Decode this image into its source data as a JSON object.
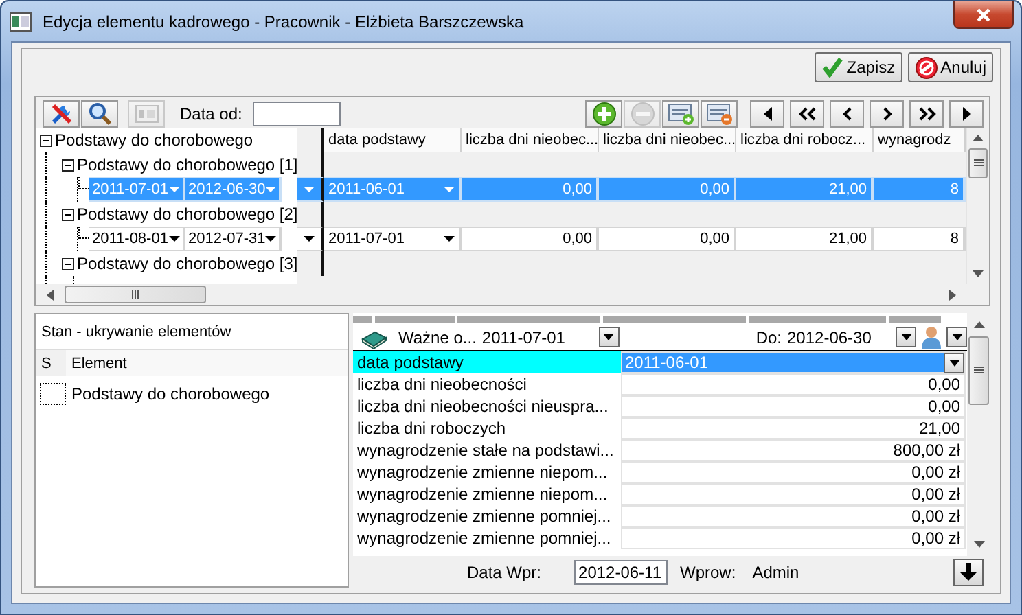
{
  "window": {
    "title": "Edycja elementu kadrowego - Pracownik - Elżbieta Barszczewska"
  },
  "actions": [
    {
      "kind": "save",
      "label": "Zapisz"
    },
    {
      "kind": "cancel",
      "label": "Anuluj"
    }
  ],
  "toolbar": {
    "left_buttons": [
      {
        "kind": "tools",
        "disabled": false
      },
      {
        "kind": "search",
        "disabled": false
      },
      {
        "kind": "counter",
        "disabled": true
      }
    ],
    "date_from_label": "Data od:",
    "right_buttons": [
      {
        "kind": "add",
        "disabled": false
      },
      {
        "kind": "remove",
        "disabled": true
      },
      {
        "kind": "add_record",
        "disabled": false
      },
      {
        "kind": "remove_record",
        "disabled": false
      }
    ],
    "nav_buttons": [
      {
        "kind": "first"
      },
      {
        "kind": "fast_back"
      },
      {
        "kind": "back"
      },
      {
        "kind": "forward"
      },
      {
        "kind": "fast_forward"
      },
      {
        "kind": "last"
      }
    ]
  },
  "grid": {
    "columns": [
      "data podstawy",
      "liczba dni nieobec...",
      "liczba dni nieobec...",
      "liczba dni robocz...",
      "wynagrodz"
    ],
    "tree": {
      "label": "Podstawy do chorobowego",
      "expanded": true,
      "children": [
        {
          "label": "Podstawy do chorobowego [1]",
          "expanded": true,
          "children": [
            {
              "from": "2011-07-01",
              "to": "2012-06-30",
              "selected": true,
              "cells": [
                "2011-06-01",
                "0,00",
                "0,00",
                "21,00",
                "8"
              ]
            }
          ]
        },
        {
          "label": "Podstawy do chorobowego [2]",
          "expanded": true,
          "children": [
            {
              "from": "2011-08-01",
              "to": "2012-07-31",
              "selected": false,
              "cells": [
                "2011-07-01",
                "0,00",
                "0,00",
                "21,00",
                "8"
              ]
            }
          ]
        },
        {
          "label": "Podstawy do chorobowego [3]",
          "expanded": true
        }
      ]
    }
  },
  "state_panel": {
    "title": "Stan - ukrywanie elementów",
    "columns": [
      "S",
      "Element"
    ],
    "items": [
      {
        "label": "Podstawy do chorobowego",
        "checked": false
      }
    ]
  },
  "validity": {
    "from_label": "Ważne o...",
    "from": "2011-07-01",
    "to_label": "Do:",
    "to": "2012-06-30"
  },
  "properties": [
    {
      "label": "data podstawy",
      "value": "2011-06-01",
      "kind": "dropdown",
      "selected": true
    },
    {
      "label": "liczba dni nieobecności",
      "value": "0,00",
      "kind": "number",
      "selected": false
    },
    {
      "label": "liczba dni nieobecności nieuspra...",
      "value": "0,00",
      "kind": "number",
      "selected": false
    },
    {
      "label": "liczba dni roboczych",
      "value": "21,00",
      "kind": "number",
      "selected": false
    },
    {
      "label": "wynagrodzenie stałe na podstawi...",
      "value": "800,00 zł",
      "kind": "number",
      "selected": false
    },
    {
      "label": "wynagrodzenie zmienne niepom...",
      "value": "0,00 zł",
      "kind": "number",
      "selected": false
    },
    {
      "label": "wynagrodzenie zmienne niepom...",
      "value": "0,00 zł",
      "kind": "number",
      "selected": false
    },
    {
      "label": "wynagrodzenie zmienne pomniej...",
      "value": "0,00 zł",
      "kind": "number",
      "selected": false
    },
    {
      "label": "wynagrodzenie zmienne pomniej...",
      "value": "0,00 zł",
      "kind": "number",
      "selected": false
    }
  ],
  "footer": {
    "entry_date_label": "Data Wpr:",
    "entry_date": "2012-06-11",
    "entered_by_label": "Wprow:",
    "entered_by": "Admin"
  }
}
